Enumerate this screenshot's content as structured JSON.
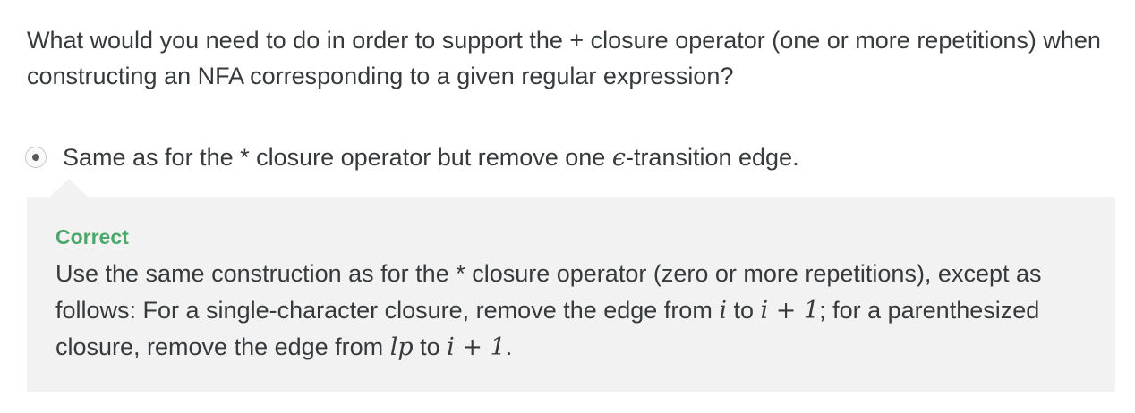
{
  "question": {
    "text": "What would you need to do in order to support the + closure operator (one or more repetitions) when constructing an NFA corresponding to a given regular expression?"
  },
  "option": {
    "text_before": "Same as for the * closure operator but remove one ",
    "epsilon": "ϵ",
    "text_after": "-transition edge.",
    "selected": true
  },
  "feedback": {
    "title": "Correct",
    "body_1": "Use the same construction as for the * closure operator (zero or more repetitions), except as follows: For a single-character closure, remove the edge from ",
    "var_i_1": "i",
    "body_2": " to ",
    "expr_1": "i + 1",
    "body_3": "; for a parenthesized closure, remove the edge from ",
    "var_lp": "lp",
    "body_4": " to ",
    "expr_2": "i + 1",
    "body_5": "."
  },
  "colors": {
    "correct": "#49a86a",
    "feedback_bg": "#f2f2f2",
    "text": "#373a3c"
  }
}
